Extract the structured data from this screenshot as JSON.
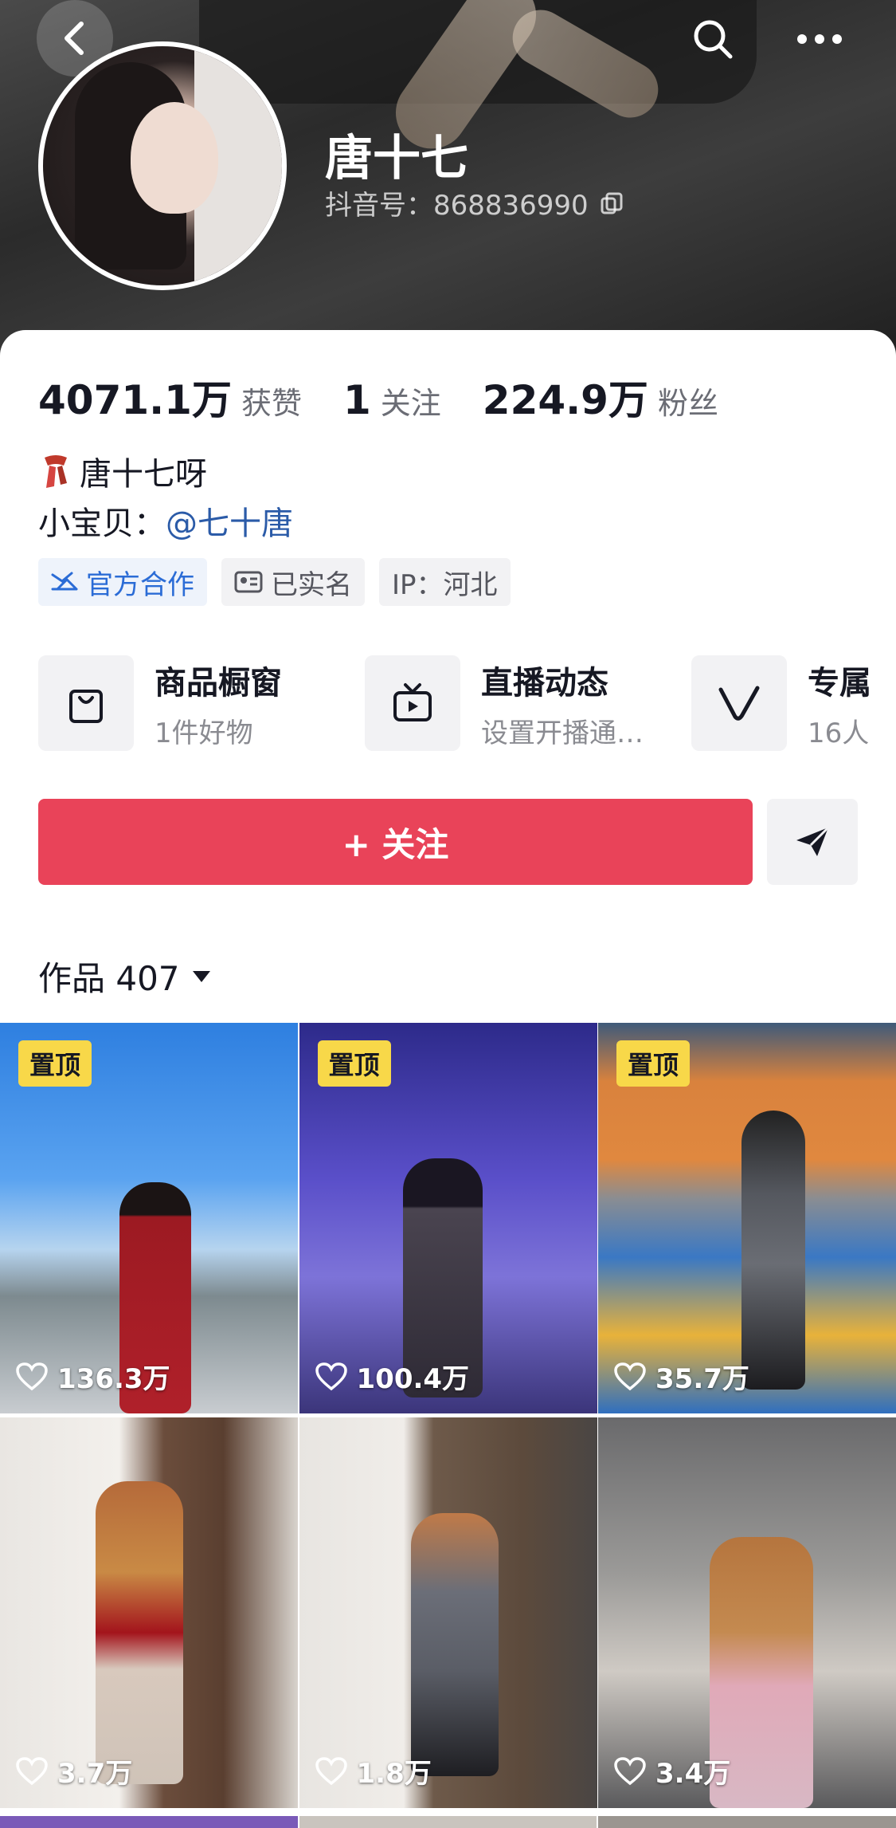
{
  "header": {
    "nickname": "唐十七",
    "douyin_id": "抖音号：868836990"
  },
  "stats": [
    {
      "value": "4071.1万",
      "label": "获赞"
    },
    {
      "value": "1",
      "label": "关注"
    },
    {
      "value": "224.9万",
      "label": "粉丝"
    }
  ],
  "bio": {
    "line1": "唐十七呀",
    "line2_prefix": "小宝贝：",
    "line2_mention": "@七十唐"
  },
  "tags": {
    "official": "官方合作",
    "verified": "已实名",
    "ip": "IP：河北"
  },
  "features": [
    {
      "title": "商品橱窗",
      "subtitle": "1件好物",
      "icon": "shopping-bag-icon"
    },
    {
      "title": "直播动态",
      "subtitle": "设置开播通…",
      "icon": "tv-icon"
    },
    {
      "title": "专属",
      "subtitle": "16人",
      "icon": "v-icon"
    }
  ],
  "actions": {
    "follow_label": "+ 关注"
  },
  "works": {
    "title": "作品 407"
  },
  "videos": [
    {
      "pinned": "置顶",
      "likes": "136.3万"
    },
    {
      "pinned": "置顶",
      "likes": "100.4万"
    },
    {
      "pinned": "置顶",
      "likes": "35.7万"
    },
    {
      "pinned": "",
      "likes": "3.7万"
    },
    {
      "pinned": "",
      "likes": "1.8万"
    },
    {
      "pinned": "",
      "likes": "3.4万"
    }
  ],
  "colors": {
    "follow": "#e94359",
    "pin": "#f8d849",
    "mention": "#2b5ba8",
    "official": "#2b6cd6"
  }
}
